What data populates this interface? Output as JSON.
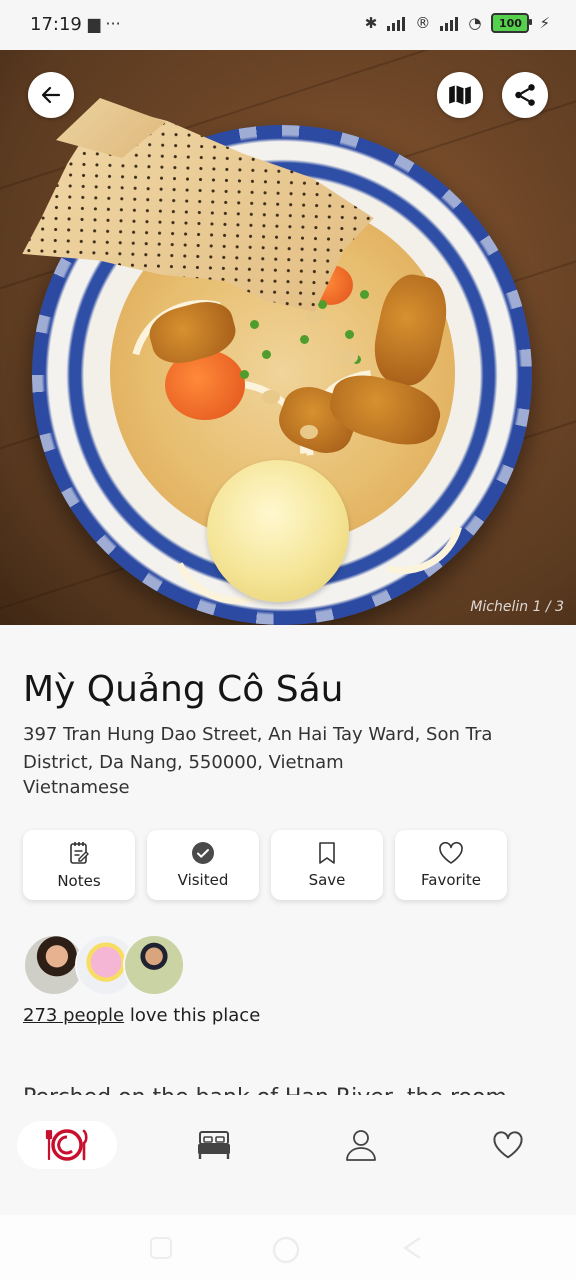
{
  "status_bar": {
    "time": "17:19",
    "left_icons": "▆ ···",
    "battery": "100"
  },
  "hero": {
    "photo_credit": "Michelin 1 / 3",
    "back_icon": "arrow-left-icon",
    "map_icon": "map-icon",
    "share_icon": "share-icon"
  },
  "restaurant": {
    "name": "Mỳ Quảng Cô Sáu",
    "address": "397 Tran Hung Dao Street, An Hai Tay Ward, Son Tra District, Da Nang, 550000, Vietnam",
    "cuisine": "Vietnamese"
  },
  "actions": [
    {
      "label": "Notes",
      "icon": "notes-icon"
    },
    {
      "label": "Visited",
      "icon": "check-circle-icon"
    },
    {
      "label": "Save",
      "icon": "bookmark-icon"
    },
    {
      "label": "Favorite",
      "icon": "heart-icon"
    }
  ],
  "social": {
    "people_link": "273 people",
    "love_text": " love this place"
  },
  "description_peek": "Perched on the bank of Han River, the room",
  "bottom_nav": [
    {
      "name": "dining",
      "icon": "plate-cutlery-icon",
      "active": true
    },
    {
      "name": "hotels",
      "icon": "bed-icon",
      "active": false
    },
    {
      "name": "profile",
      "icon": "person-icon",
      "active": false
    },
    {
      "name": "favorites",
      "icon": "heart-icon",
      "active": false
    }
  ],
  "colors": {
    "accent": "#c8102e",
    "background": "#f7f7f7"
  }
}
